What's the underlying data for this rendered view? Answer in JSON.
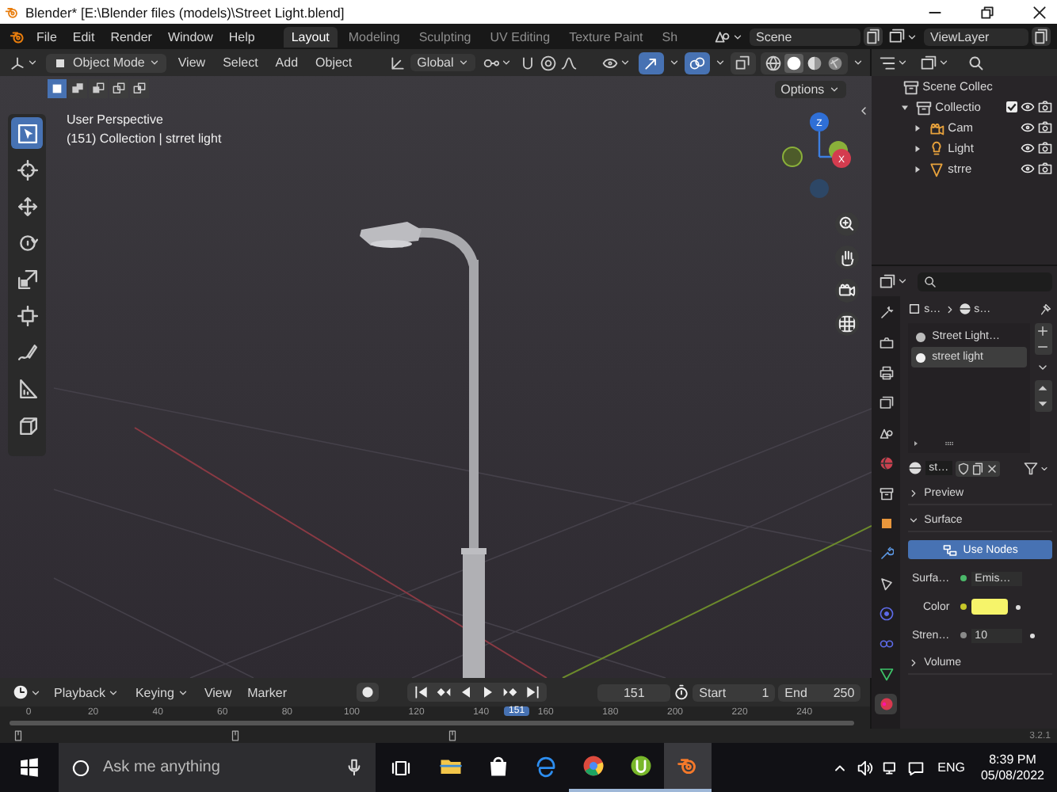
{
  "window": {
    "title": "Blender* [E:\\Blender files (models)\\Street Light.blend]"
  },
  "menu": [
    "File",
    "Edit",
    "Render",
    "Window",
    "Help"
  ],
  "workspaces": [
    {
      "label": "Layout",
      "selected": true
    },
    {
      "label": "Modeling",
      "selected": false
    },
    {
      "label": "Sculpting",
      "selected": false
    },
    {
      "label": "UV Editing",
      "selected": false
    },
    {
      "label": "Texture Paint",
      "selected": false
    },
    {
      "label": "Sh",
      "selected": false
    }
  ],
  "scene": "Scene",
  "view_layer": "ViewLayer",
  "viewport": {
    "mode": "Object Mode",
    "menus": [
      "View",
      "Select",
      "Add",
      "Object"
    ],
    "orientation": "Global",
    "toggles": [
      {
        "kind": "gizmo",
        "on": true
      },
      {
        "kind": "overlay",
        "on": true
      },
      {
        "kind": "xray",
        "on": false
      }
    ],
    "shading": [
      {
        "kind": "wireframe",
        "selected": false
      },
      {
        "kind": "solid",
        "selected": true
      },
      {
        "kind": "material",
        "selected": false
      },
      {
        "kind": "rendered",
        "selected": false
      }
    ],
    "select_modes": [
      {
        "kind": "set",
        "selected": true
      },
      {
        "kind": "extend",
        "selected": false
      },
      {
        "kind": "subtract",
        "selected": false
      },
      {
        "kind": "invert",
        "selected": false
      },
      {
        "kind": "intersect",
        "selected": false
      }
    ],
    "options": "Options",
    "tools": [
      {
        "kind": "select",
        "selected": true
      },
      {
        "kind": "cursor",
        "selected": false
      },
      {
        "kind": "move",
        "selected": false
      },
      {
        "kind": "rotate",
        "selected": false
      },
      {
        "kind": "scale",
        "selected": false
      },
      {
        "kind": "transform",
        "selected": false
      },
      {
        "kind": "annotate",
        "selected": false
      },
      {
        "kind": "measure",
        "selected": false
      },
      {
        "kind": "add_cube",
        "selected": false
      }
    ],
    "view_name": "User Perspective",
    "context": "(151) Collection | strret light",
    "gizmo_axes": [
      "Z",
      "X"
    ]
  },
  "outliner": {
    "items": [
      {
        "label": "Scene Collec",
        "kind": "scene_collection",
        "children": [
          {
            "label": "Collectio",
            "kind": "collection",
            "expanded": true,
            "checked": true,
            "children": [
              {
                "label": "Cam",
                "kind": "camera",
                "expanded": false
              },
              {
                "label": "Light",
                "kind": "light",
                "expanded": false
              },
              {
                "label": "strre",
                "kind": "mesh",
                "expanded": false
              }
            ]
          }
        ]
      }
    ]
  },
  "properties": {
    "tabs": [
      {
        "kind": "tool",
        "selected": false
      },
      {
        "kind": "render",
        "selected": false
      },
      {
        "kind": "output",
        "selected": false
      },
      {
        "kind": "view_layer",
        "selected": false
      },
      {
        "kind": "scene",
        "selected": false
      },
      {
        "kind": "world",
        "selected": false
      },
      {
        "kind": "collection",
        "selected": false
      },
      {
        "kind": "object",
        "selected": false
      },
      {
        "kind": "modifier",
        "selected": false
      },
      {
        "kind": "particles",
        "selected": false
      },
      {
        "kind": "physics",
        "selected": false
      },
      {
        "kind": "constraints",
        "selected": false
      },
      {
        "kind": "data",
        "selected": false
      },
      {
        "kind": "material",
        "selected": true
      }
    ],
    "breadcrumb": [
      "s…",
      "s…"
    ],
    "slots": [
      {
        "label": "Street Light…",
        "selected": false
      },
      {
        "label": "street light",
        "selected": true
      }
    ],
    "material": "st…",
    "panels": [
      {
        "label": "Preview",
        "expanded": false
      },
      {
        "label": "Surface",
        "expanded": true,
        "use_nodes": "Use Nodes",
        "fields": [
          {
            "kind": "shader",
            "label": "Surfa…",
            "value": "Emis…"
          },
          {
            "kind": "color",
            "label": "Color",
            "color": "#f6f46a"
          },
          {
            "kind": "number",
            "label": "Stren…",
            "value": "10"
          }
        ]
      },
      {
        "label": "Volume",
        "expanded": false
      }
    ]
  },
  "timeline": {
    "menus": [
      "Playback",
      "Keying",
      "View",
      "Marker"
    ],
    "frame": "151",
    "start_label": "Start",
    "start": "1",
    "end_label": "End",
    "end": "250",
    "ticks": [
      "0",
      "20",
      "40",
      "60",
      "80",
      "100",
      "120",
      "140",
      "160",
      "180",
      "200",
      "220",
      "240"
    ],
    "current": "151"
  },
  "status": {
    "version": "3.2.1"
  },
  "taskbar": {
    "search": "Ask me anything",
    "apps": [
      {
        "kind": "explorer",
        "running": false,
        "selected": false
      },
      {
        "kind": "store",
        "running": false,
        "selected": false
      },
      {
        "kind": "edge",
        "running": false,
        "selected": false
      },
      {
        "kind": "chrome",
        "running": true,
        "selected": false
      },
      {
        "kind": "utorrent",
        "running": true,
        "selected": false
      },
      {
        "kind": "blender",
        "running": true,
        "selected": true
      }
    ],
    "language": "ENG",
    "time": "8:39 PM",
    "date": "05/08/2022"
  }
}
